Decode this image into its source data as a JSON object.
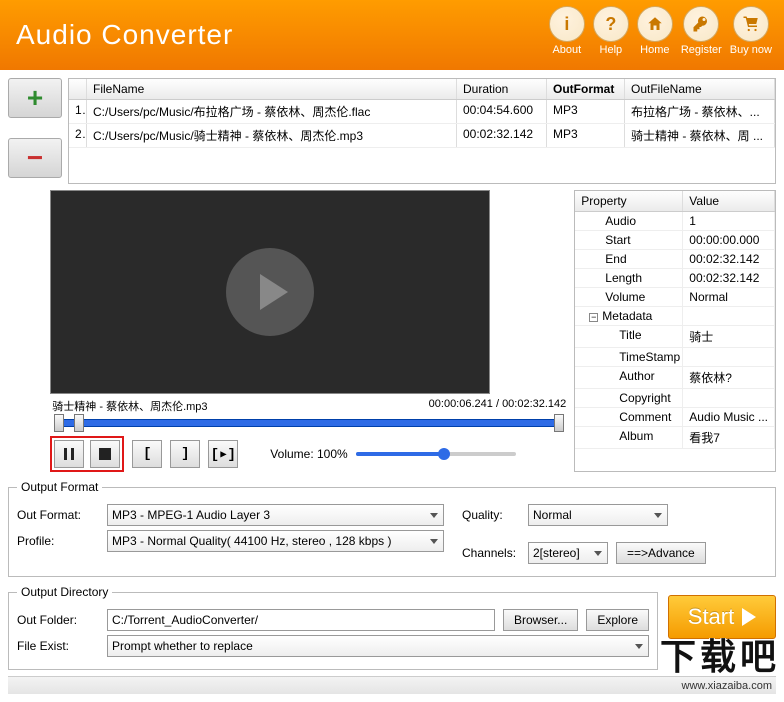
{
  "title": "Audio Converter",
  "header_buttons": [
    {
      "label": "About"
    },
    {
      "label": "Help"
    },
    {
      "label": "Home"
    },
    {
      "label": "Register"
    },
    {
      "label": "Buy now"
    }
  ],
  "file_table": {
    "headers": {
      "filename": "FileName",
      "duration": "Duration",
      "outformat": "OutFormat",
      "outfilename": "OutFileName"
    },
    "rows": [
      {
        "idx": "1",
        "filename": "C:/Users/pc/Music/布拉格广场 - 蔡依林、周杰伦.flac",
        "duration": "00:04:54.600",
        "outformat": "MP3",
        "outfilename": "布拉格广场 - 蔡依林、..."
      },
      {
        "idx": "2",
        "filename": "C:/Users/pc/Music/骑士精神 - 蔡依林、周杰伦.mp3",
        "duration": "00:02:32.142",
        "outformat": "MP3",
        "outfilename": "骑士精神 - 蔡依林、周 ..."
      }
    ]
  },
  "properties": {
    "headers": {
      "property": "Property",
      "value": "Value"
    },
    "rows": [
      {
        "k": "Audio",
        "v": "1",
        "lvl": 1
      },
      {
        "k": "Start",
        "v": "00:00:00.000",
        "lvl": 1
      },
      {
        "k": "End",
        "v": "00:02:32.142",
        "lvl": 1
      },
      {
        "k": "Length",
        "v": "00:02:32.142",
        "lvl": 1
      },
      {
        "k": "Volume",
        "v": "Normal",
        "lvl": 1
      },
      {
        "k": "Metadata",
        "v": "",
        "lvl": 0,
        "exp": true
      },
      {
        "k": "Title",
        "v": "骑士",
        "lvl": 2
      },
      {
        "k": "TimeStamp",
        "v": "",
        "lvl": 2
      },
      {
        "k": "Author",
        "v": "蔡依林?",
        "lvl": 2
      },
      {
        "k": "Copyright",
        "v": "",
        "lvl": 2
      },
      {
        "k": "Comment",
        "v": "Audio Music ...",
        "lvl": 2
      },
      {
        "k": "Album",
        "v": "看我7",
        "lvl": 2
      }
    ]
  },
  "player": {
    "now_playing": "骑士精神 - 蔡依林、周杰伦.mp3",
    "position": "00:00:06.241",
    "total": "00:02:32.142",
    "volume_label": "Volume: 100%",
    "seek_pct": 4,
    "vol_pct": 55
  },
  "output_format": {
    "legend": "Output Format",
    "labels": {
      "out_format": "Out Format:",
      "profile": "Profile:",
      "quality": "Quality:",
      "channels": "Channels:"
    },
    "out_format": "MP3 - MPEG-1 Audio Layer 3",
    "profile": "MP3 - Normal Quality( 44100 Hz, stereo , 128 kbps )",
    "quality": "Normal",
    "channels": "2[stereo]",
    "advance": "==>Advance"
  },
  "output_dir": {
    "legend": "Output Directory",
    "labels": {
      "out_folder": "Out Folder:",
      "file_exist": "File Exist:"
    },
    "out_folder": "C:/Torrent_AudioConverter/",
    "browser": "Browser...",
    "explore": "Explore",
    "file_exist": "Prompt whether to replace"
  },
  "start": "Start",
  "watermark": "下载吧",
  "watermark_url": "www.xiazaiba.com"
}
